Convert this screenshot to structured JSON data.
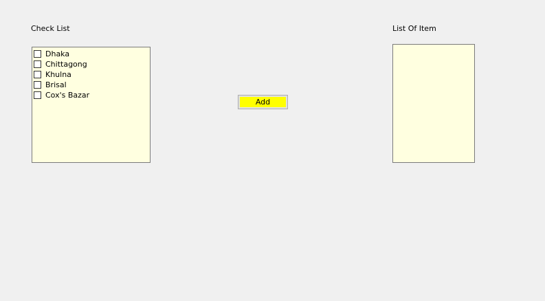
{
  "checklist": {
    "label": "Check List",
    "items": [
      {
        "label": "Dhaka",
        "checked": false
      },
      {
        "label": "Chittagong",
        "checked": false
      },
      {
        "label": "Khulna",
        "checked": false
      },
      {
        "label": "Brisal",
        "checked": false
      },
      {
        "label": "Cox's Bazar",
        "checked": false
      }
    ]
  },
  "add_button": {
    "label": "Add",
    "color": "#ffff00"
  },
  "list_of_item": {
    "label": "List Of Item",
    "items": []
  },
  "colors": {
    "background": "#f0f0f0",
    "listbox_background": "#ffffe0"
  }
}
